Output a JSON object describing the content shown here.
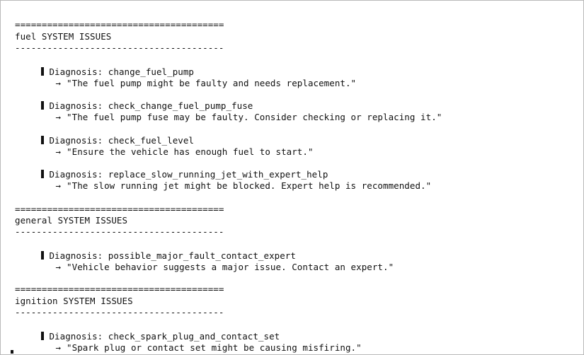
{
  "window": {
    "title": ""
  },
  "sections": [
    {
      "top_rule": "=======================================",
      "title": "fuel SYSTEM ISSUES",
      "bottom_rule": "---------------------------------------",
      "entries": [
        {
          "diagnosis": "Diagnosis: change_fuel_pump",
          "detail": "\"The fuel pump might be faulty and needs replacement.\""
        },
        {
          "diagnosis": "Diagnosis: check_change_fuel_pump_fuse",
          "detail": "\"The fuel pump fuse may be faulty. Consider checking or replacing it.\""
        },
        {
          "diagnosis": "Diagnosis: check_fuel_level",
          "detail": "\"Ensure the vehicle has enough fuel to start.\""
        },
        {
          "diagnosis": "Diagnosis: replace_slow_running_jet_with_expert_help",
          "detail": "\"The slow running jet might be blocked. Expert help is recommended.\""
        }
      ]
    },
    {
      "top_rule": "=======================================",
      "title": "general SYSTEM ISSUES",
      "bottom_rule": "---------------------------------------",
      "entries": [
        {
          "diagnosis": "Diagnosis: possible_major_fault_contact_expert",
          "detail": "\"Vehicle behavior suggests a major issue. Contact an expert.\""
        }
      ]
    },
    {
      "top_rule": "=======================================",
      "title": "ignition SYSTEM ISSUES",
      "bottom_rule": "---------------------------------------",
      "entries": [
        {
          "diagnosis": "Diagnosis: check_spark_plug_and_contact_set",
          "detail": "\"Spark plug or contact set might be causing misfiring.\""
        }
      ]
    }
  ],
  "symbols": {
    "arrow": "→",
    "bullet_icon": "vertical-bar-marker-icon"
  }
}
